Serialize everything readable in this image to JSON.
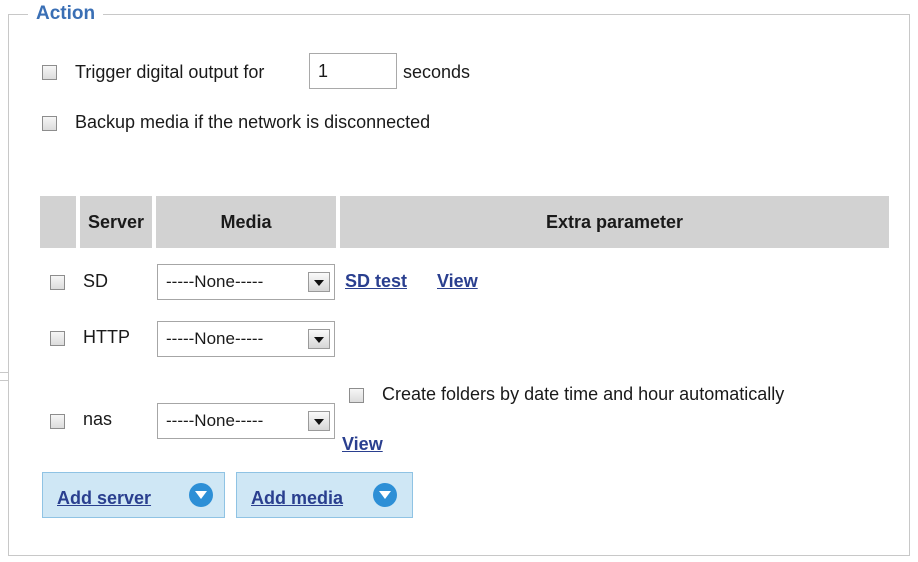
{
  "section": {
    "title": "Action"
  },
  "trigger": {
    "label": "Trigger digital output for",
    "value": "1",
    "unit": "seconds"
  },
  "backup": {
    "label": "Backup media if the network is disconnected"
  },
  "table": {
    "headers": {
      "server": "Server",
      "media": "Media",
      "extra": "Extra parameter"
    },
    "rows": [
      {
        "server": "SD",
        "media": "-----None-----",
        "links": [
          "SD test",
          "View"
        ]
      },
      {
        "server": "HTTP",
        "media": "-----None-----"
      },
      {
        "server": "nas",
        "media": "-----None-----",
        "option": "Create folders by date time and hour automatically",
        "link": "View"
      }
    ]
  },
  "buttons": {
    "add_server": "Add server",
    "add_media": "Add media"
  },
  "colors": {
    "legend": "#3a6fb5",
    "header_bg": "#d2d2d2",
    "link": "#2a3f8f",
    "button_bg": "#cfe7f5",
    "button_icon": "#2d8fd6"
  },
  "icons": {
    "dropdown": "chevron-down-icon",
    "add": "circle-chevron-down-icon"
  }
}
